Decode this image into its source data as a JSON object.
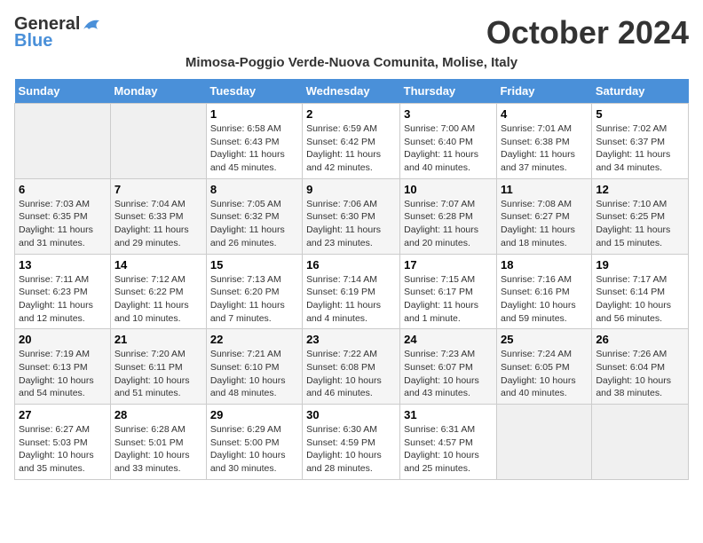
{
  "header": {
    "logo_general": "General",
    "logo_blue": "Blue",
    "month_title": "October 2024",
    "subtitle": "Mimosa-Poggio Verde-Nuova Comunita, Molise, Italy"
  },
  "days_of_week": [
    "Sunday",
    "Monday",
    "Tuesday",
    "Wednesday",
    "Thursday",
    "Friday",
    "Saturday"
  ],
  "weeks": [
    [
      {
        "day": "",
        "info": ""
      },
      {
        "day": "",
        "info": ""
      },
      {
        "day": "1",
        "info": "Sunrise: 6:58 AM\nSunset: 6:43 PM\nDaylight: 11 hours and 45 minutes."
      },
      {
        "day": "2",
        "info": "Sunrise: 6:59 AM\nSunset: 6:42 PM\nDaylight: 11 hours and 42 minutes."
      },
      {
        "day": "3",
        "info": "Sunrise: 7:00 AM\nSunset: 6:40 PM\nDaylight: 11 hours and 40 minutes."
      },
      {
        "day": "4",
        "info": "Sunrise: 7:01 AM\nSunset: 6:38 PM\nDaylight: 11 hours and 37 minutes."
      },
      {
        "day": "5",
        "info": "Sunrise: 7:02 AM\nSunset: 6:37 PM\nDaylight: 11 hours and 34 minutes."
      }
    ],
    [
      {
        "day": "6",
        "info": "Sunrise: 7:03 AM\nSunset: 6:35 PM\nDaylight: 11 hours and 31 minutes."
      },
      {
        "day": "7",
        "info": "Sunrise: 7:04 AM\nSunset: 6:33 PM\nDaylight: 11 hours and 29 minutes."
      },
      {
        "day": "8",
        "info": "Sunrise: 7:05 AM\nSunset: 6:32 PM\nDaylight: 11 hours and 26 minutes."
      },
      {
        "day": "9",
        "info": "Sunrise: 7:06 AM\nSunset: 6:30 PM\nDaylight: 11 hours and 23 minutes."
      },
      {
        "day": "10",
        "info": "Sunrise: 7:07 AM\nSunset: 6:28 PM\nDaylight: 11 hours and 20 minutes."
      },
      {
        "day": "11",
        "info": "Sunrise: 7:08 AM\nSunset: 6:27 PM\nDaylight: 11 hours and 18 minutes."
      },
      {
        "day": "12",
        "info": "Sunrise: 7:10 AM\nSunset: 6:25 PM\nDaylight: 11 hours and 15 minutes."
      }
    ],
    [
      {
        "day": "13",
        "info": "Sunrise: 7:11 AM\nSunset: 6:23 PM\nDaylight: 11 hours and 12 minutes."
      },
      {
        "day": "14",
        "info": "Sunrise: 7:12 AM\nSunset: 6:22 PM\nDaylight: 11 hours and 10 minutes."
      },
      {
        "day": "15",
        "info": "Sunrise: 7:13 AM\nSunset: 6:20 PM\nDaylight: 11 hours and 7 minutes."
      },
      {
        "day": "16",
        "info": "Sunrise: 7:14 AM\nSunset: 6:19 PM\nDaylight: 11 hours and 4 minutes."
      },
      {
        "day": "17",
        "info": "Sunrise: 7:15 AM\nSunset: 6:17 PM\nDaylight: 11 hours and 1 minute."
      },
      {
        "day": "18",
        "info": "Sunrise: 7:16 AM\nSunset: 6:16 PM\nDaylight: 10 hours and 59 minutes."
      },
      {
        "day": "19",
        "info": "Sunrise: 7:17 AM\nSunset: 6:14 PM\nDaylight: 10 hours and 56 minutes."
      }
    ],
    [
      {
        "day": "20",
        "info": "Sunrise: 7:19 AM\nSunset: 6:13 PM\nDaylight: 10 hours and 54 minutes."
      },
      {
        "day": "21",
        "info": "Sunrise: 7:20 AM\nSunset: 6:11 PM\nDaylight: 10 hours and 51 minutes."
      },
      {
        "day": "22",
        "info": "Sunrise: 7:21 AM\nSunset: 6:10 PM\nDaylight: 10 hours and 48 minutes."
      },
      {
        "day": "23",
        "info": "Sunrise: 7:22 AM\nSunset: 6:08 PM\nDaylight: 10 hours and 46 minutes."
      },
      {
        "day": "24",
        "info": "Sunrise: 7:23 AM\nSunset: 6:07 PM\nDaylight: 10 hours and 43 minutes."
      },
      {
        "day": "25",
        "info": "Sunrise: 7:24 AM\nSunset: 6:05 PM\nDaylight: 10 hours and 40 minutes."
      },
      {
        "day": "26",
        "info": "Sunrise: 7:26 AM\nSunset: 6:04 PM\nDaylight: 10 hours and 38 minutes."
      }
    ],
    [
      {
        "day": "27",
        "info": "Sunrise: 6:27 AM\nSunset: 5:03 PM\nDaylight: 10 hours and 35 minutes."
      },
      {
        "day": "28",
        "info": "Sunrise: 6:28 AM\nSunset: 5:01 PM\nDaylight: 10 hours and 33 minutes."
      },
      {
        "day": "29",
        "info": "Sunrise: 6:29 AM\nSunset: 5:00 PM\nDaylight: 10 hours and 30 minutes."
      },
      {
        "day": "30",
        "info": "Sunrise: 6:30 AM\nSunset: 4:59 PM\nDaylight: 10 hours and 28 minutes."
      },
      {
        "day": "31",
        "info": "Sunrise: 6:31 AM\nSunset: 4:57 PM\nDaylight: 10 hours and 25 minutes."
      },
      {
        "day": "",
        "info": ""
      },
      {
        "day": "",
        "info": ""
      }
    ]
  ]
}
